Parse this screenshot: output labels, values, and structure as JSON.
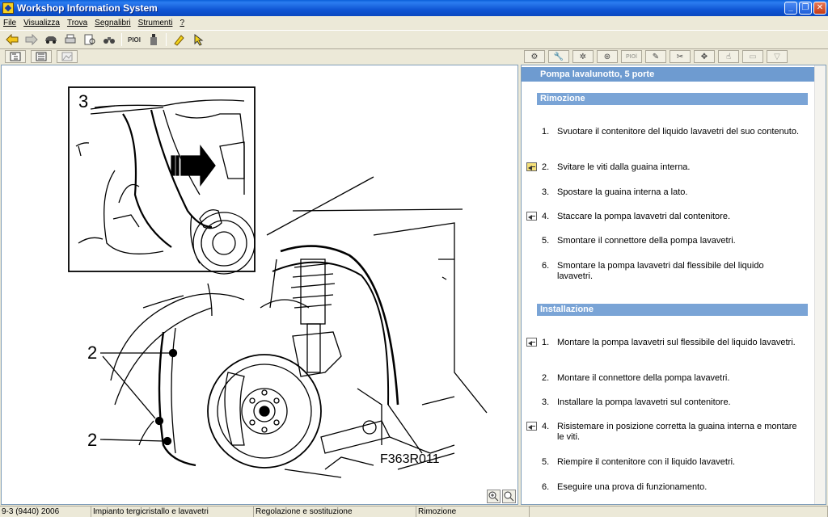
{
  "window": {
    "title": "Workshop Information System"
  },
  "menu": [
    {
      "label": "File"
    },
    {
      "label": "Visualizza"
    },
    {
      "label": "Trova"
    },
    {
      "label": "Segnalibri"
    },
    {
      "label": "Strumenti"
    },
    {
      "label": "?"
    }
  ],
  "toolbar": {
    "piol_label": "PIOl",
    "tabs_piol_label": "PIOl"
  },
  "figure": {
    "callout_3": "3",
    "callout_2a": "2",
    "callout_2b": "2",
    "figure_code": "F363R011"
  },
  "document": {
    "title": "Pompa lavalunotto, 5 porte",
    "removal": {
      "header": "Rimozione",
      "steps": [
        {
          "num": "1.",
          "text": "Svuotare il contenitore del liquido lavavetri del suo contenuto.",
          "icon": ""
        },
        {
          "num": "2.",
          "text": "Svitare le viti dalla guaina interna.",
          "icon": "yellow-arrow-icon"
        },
        {
          "num": "3.",
          "text": "Spostare la guaina interna a lato.",
          "icon": ""
        },
        {
          "num": "4.",
          "text": "Staccare la pompa lavavetri dal contenitore.",
          "icon": "arrow-icon"
        },
        {
          "num": "5.",
          "text": "Smontare il connettore della pompa lavavetri.",
          "icon": ""
        },
        {
          "num": "6.",
          "text": "Smontare la pompa lavavetri dal flessibile del liquido lavavetri.",
          "icon": ""
        }
      ]
    },
    "installation": {
      "header": "Installazione",
      "steps": [
        {
          "num": "1.",
          "text": "Montare la pompa lavavetri sul flessibile del liquido lavavetri.",
          "icon": "arrow-icon"
        },
        {
          "num": "2.",
          "text": "Montare il connettore della pompa lavavetri.",
          "icon": ""
        },
        {
          "num": "3.",
          "text": "Installare la pompa lavavetri sul contenitore.",
          "icon": ""
        },
        {
          "num": "4.",
          "text": "Risistemare in posizione corretta la guaina interna e montare le viti.",
          "icon": "arrow-icon"
        },
        {
          "num": "5.",
          "text": "Riempire il contenitore con il liquido lavavetri.",
          "icon": ""
        },
        {
          "num": "6.",
          "text": "Eseguire una prova di funzionamento.",
          "icon": ""
        }
      ]
    }
  },
  "status": {
    "model": "9-3 (9440) 2006",
    "group": "Impianto tergicristallo e lavavetri",
    "category": "Regolazione e sostituzione",
    "section": "Rimozione"
  }
}
